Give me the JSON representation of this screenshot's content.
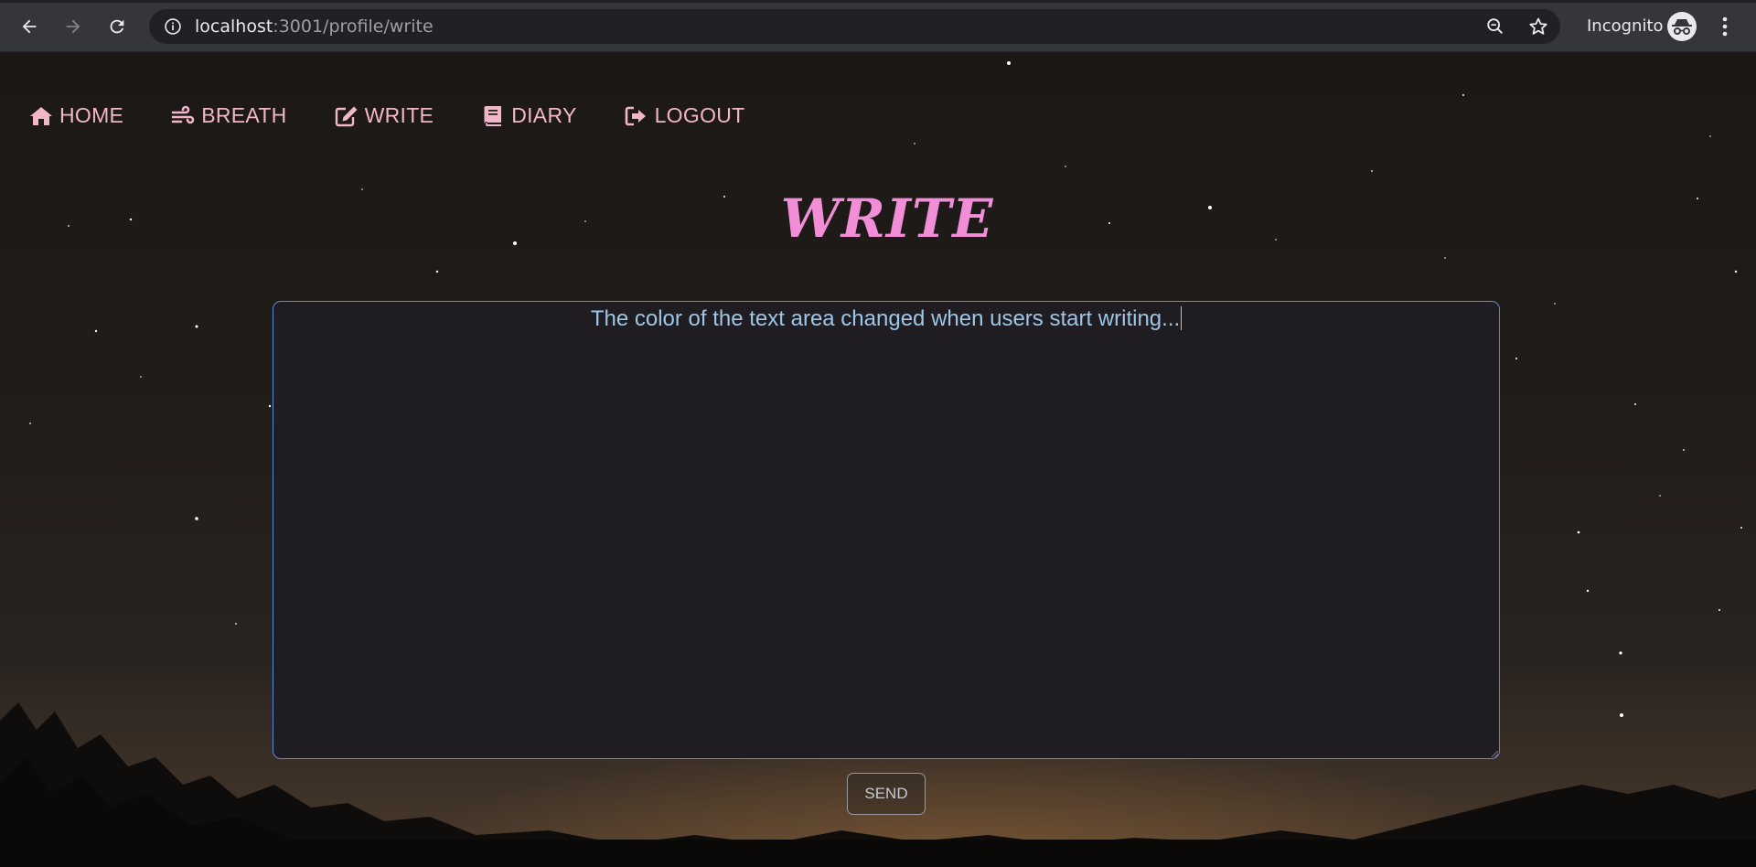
{
  "browser": {
    "url_host": "localhost",
    "url_path": ":3001/profile/write",
    "incognito_label": "Incognito",
    "icons": [
      "back-icon",
      "forward-icon",
      "reload-icon",
      "info-icon",
      "zoom-icon",
      "star-icon",
      "incognito-icon",
      "menu-icon"
    ]
  },
  "nav": {
    "items": [
      {
        "label": "HOME",
        "icon": "home-icon"
      },
      {
        "label": "BREATH",
        "icon": "wind-icon"
      },
      {
        "label": "WRITE",
        "icon": "edit-icon"
      },
      {
        "label": "DIARY",
        "icon": "book-icon"
      },
      {
        "label": "LOGOUT",
        "icon": "sign-out-icon"
      }
    ]
  },
  "main": {
    "title": "WRITE",
    "textarea_value": "The color of the text area changed when users start writing...",
    "send_label": "SEND"
  },
  "colors": {
    "nav_text": "#f2b6c9",
    "title": "#f28ed8",
    "textarea_text": "#9ec6e6",
    "textarea_border": "#5e8bd6",
    "textarea_bg": "#201d22"
  }
}
